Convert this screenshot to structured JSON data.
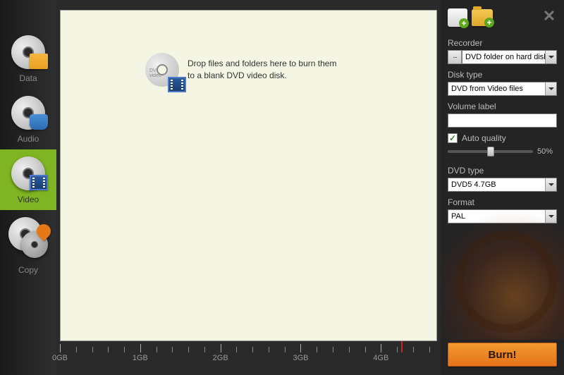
{
  "sidebar": {
    "items": [
      {
        "label": "Data"
      },
      {
        "label": "Audio"
      },
      {
        "label": "Video"
      },
      {
        "label": "Copy"
      }
    ]
  },
  "drop_area": {
    "disc_label": "DVD\nvideo",
    "text": "Drop files and folders here to burn them\nto a blank DVD video disk."
  },
  "ruler": {
    "labels": [
      "0GB",
      "1GB",
      "2GB",
      "3GB",
      "4GB"
    ],
    "marker_position_pct": 90.5
  },
  "panel": {
    "recorder": {
      "label": "Recorder",
      "browse": "...",
      "value": "DVD folder on hard disk"
    },
    "disk_type": {
      "label": "Disk type",
      "value": "DVD from Video files"
    },
    "volume_label": {
      "label": "Volume label",
      "value": ""
    },
    "auto_quality": {
      "label": "Auto quality",
      "checked": true,
      "slider_value": "50%",
      "slider_pos_pct": 50
    },
    "dvd_type": {
      "label": "DVD type",
      "value": "DVD5 4.7GB"
    },
    "format": {
      "label": "Format",
      "value": "PAL"
    },
    "burn_label": "Burn!"
  }
}
